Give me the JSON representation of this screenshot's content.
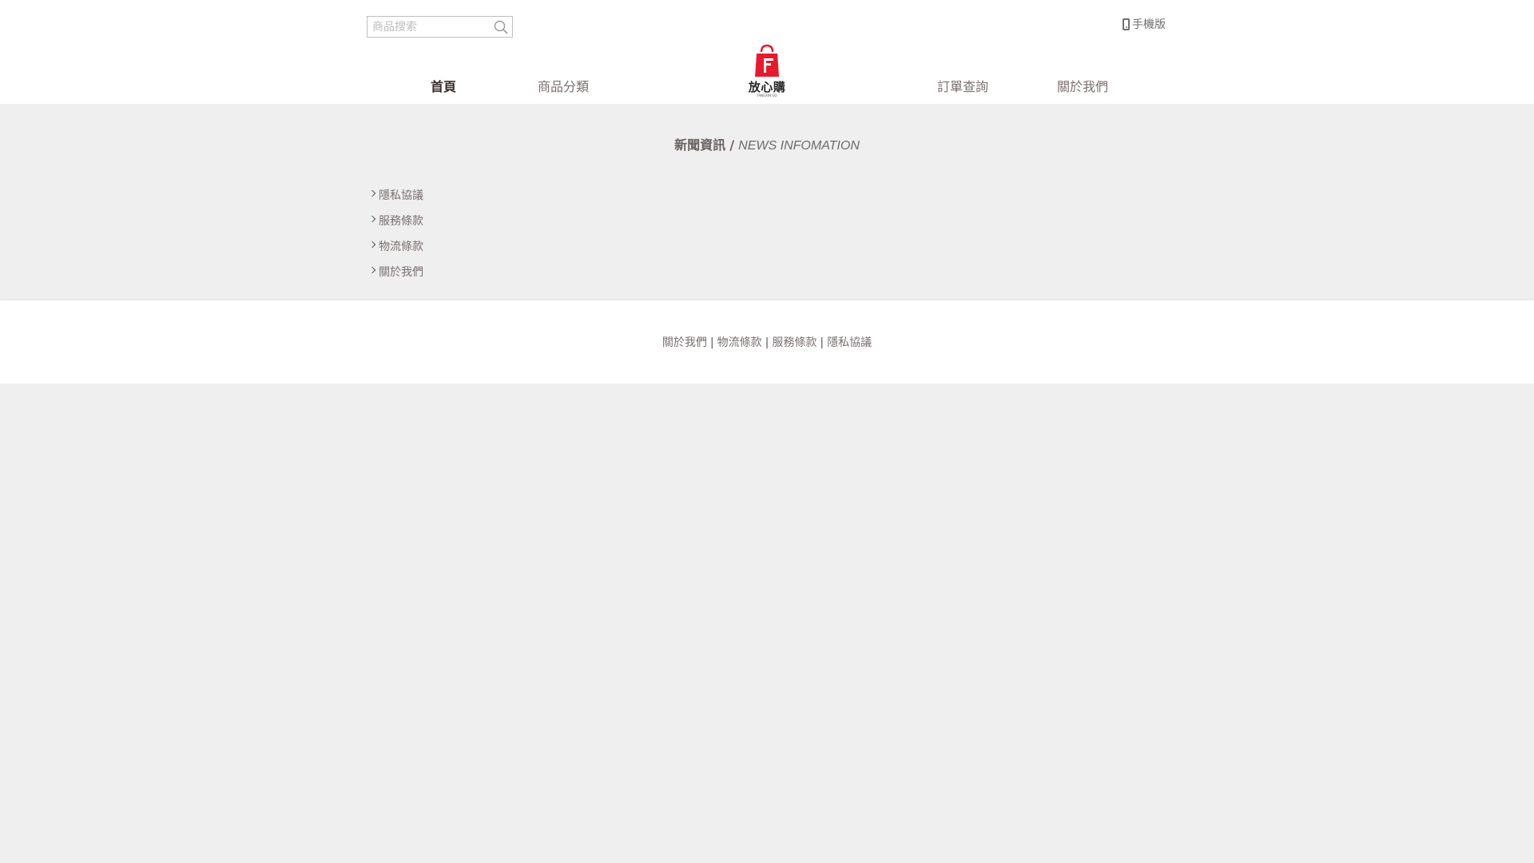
{
  "search": {
    "placeholder": "商品搜索"
  },
  "header": {
    "mobile_label": "手機版"
  },
  "nav": {
    "home": "首頁",
    "categories": "商品分類",
    "order_query": "訂單查詢",
    "about": "關於我們"
  },
  "logo": {
    "text": "放心購",
    "sub": "FANGXIN GO",
    "brand_color": "#e8192c"
  },
  "news": {
    "title_zh": "新聞資訊",
    "separator": "/",
    "title_en": "NEWS INFOMATION"
  },
  "side_links": [
    "隱私協議",
    "服務條款",
    "物流條款",
    "關於我們"
  ],
  "footer": {
    "links": [
      "關於我們",
      "物流條款",
      "服務條款",
      "隱私協議"
    ],
    "separator": "|"
  }
}
